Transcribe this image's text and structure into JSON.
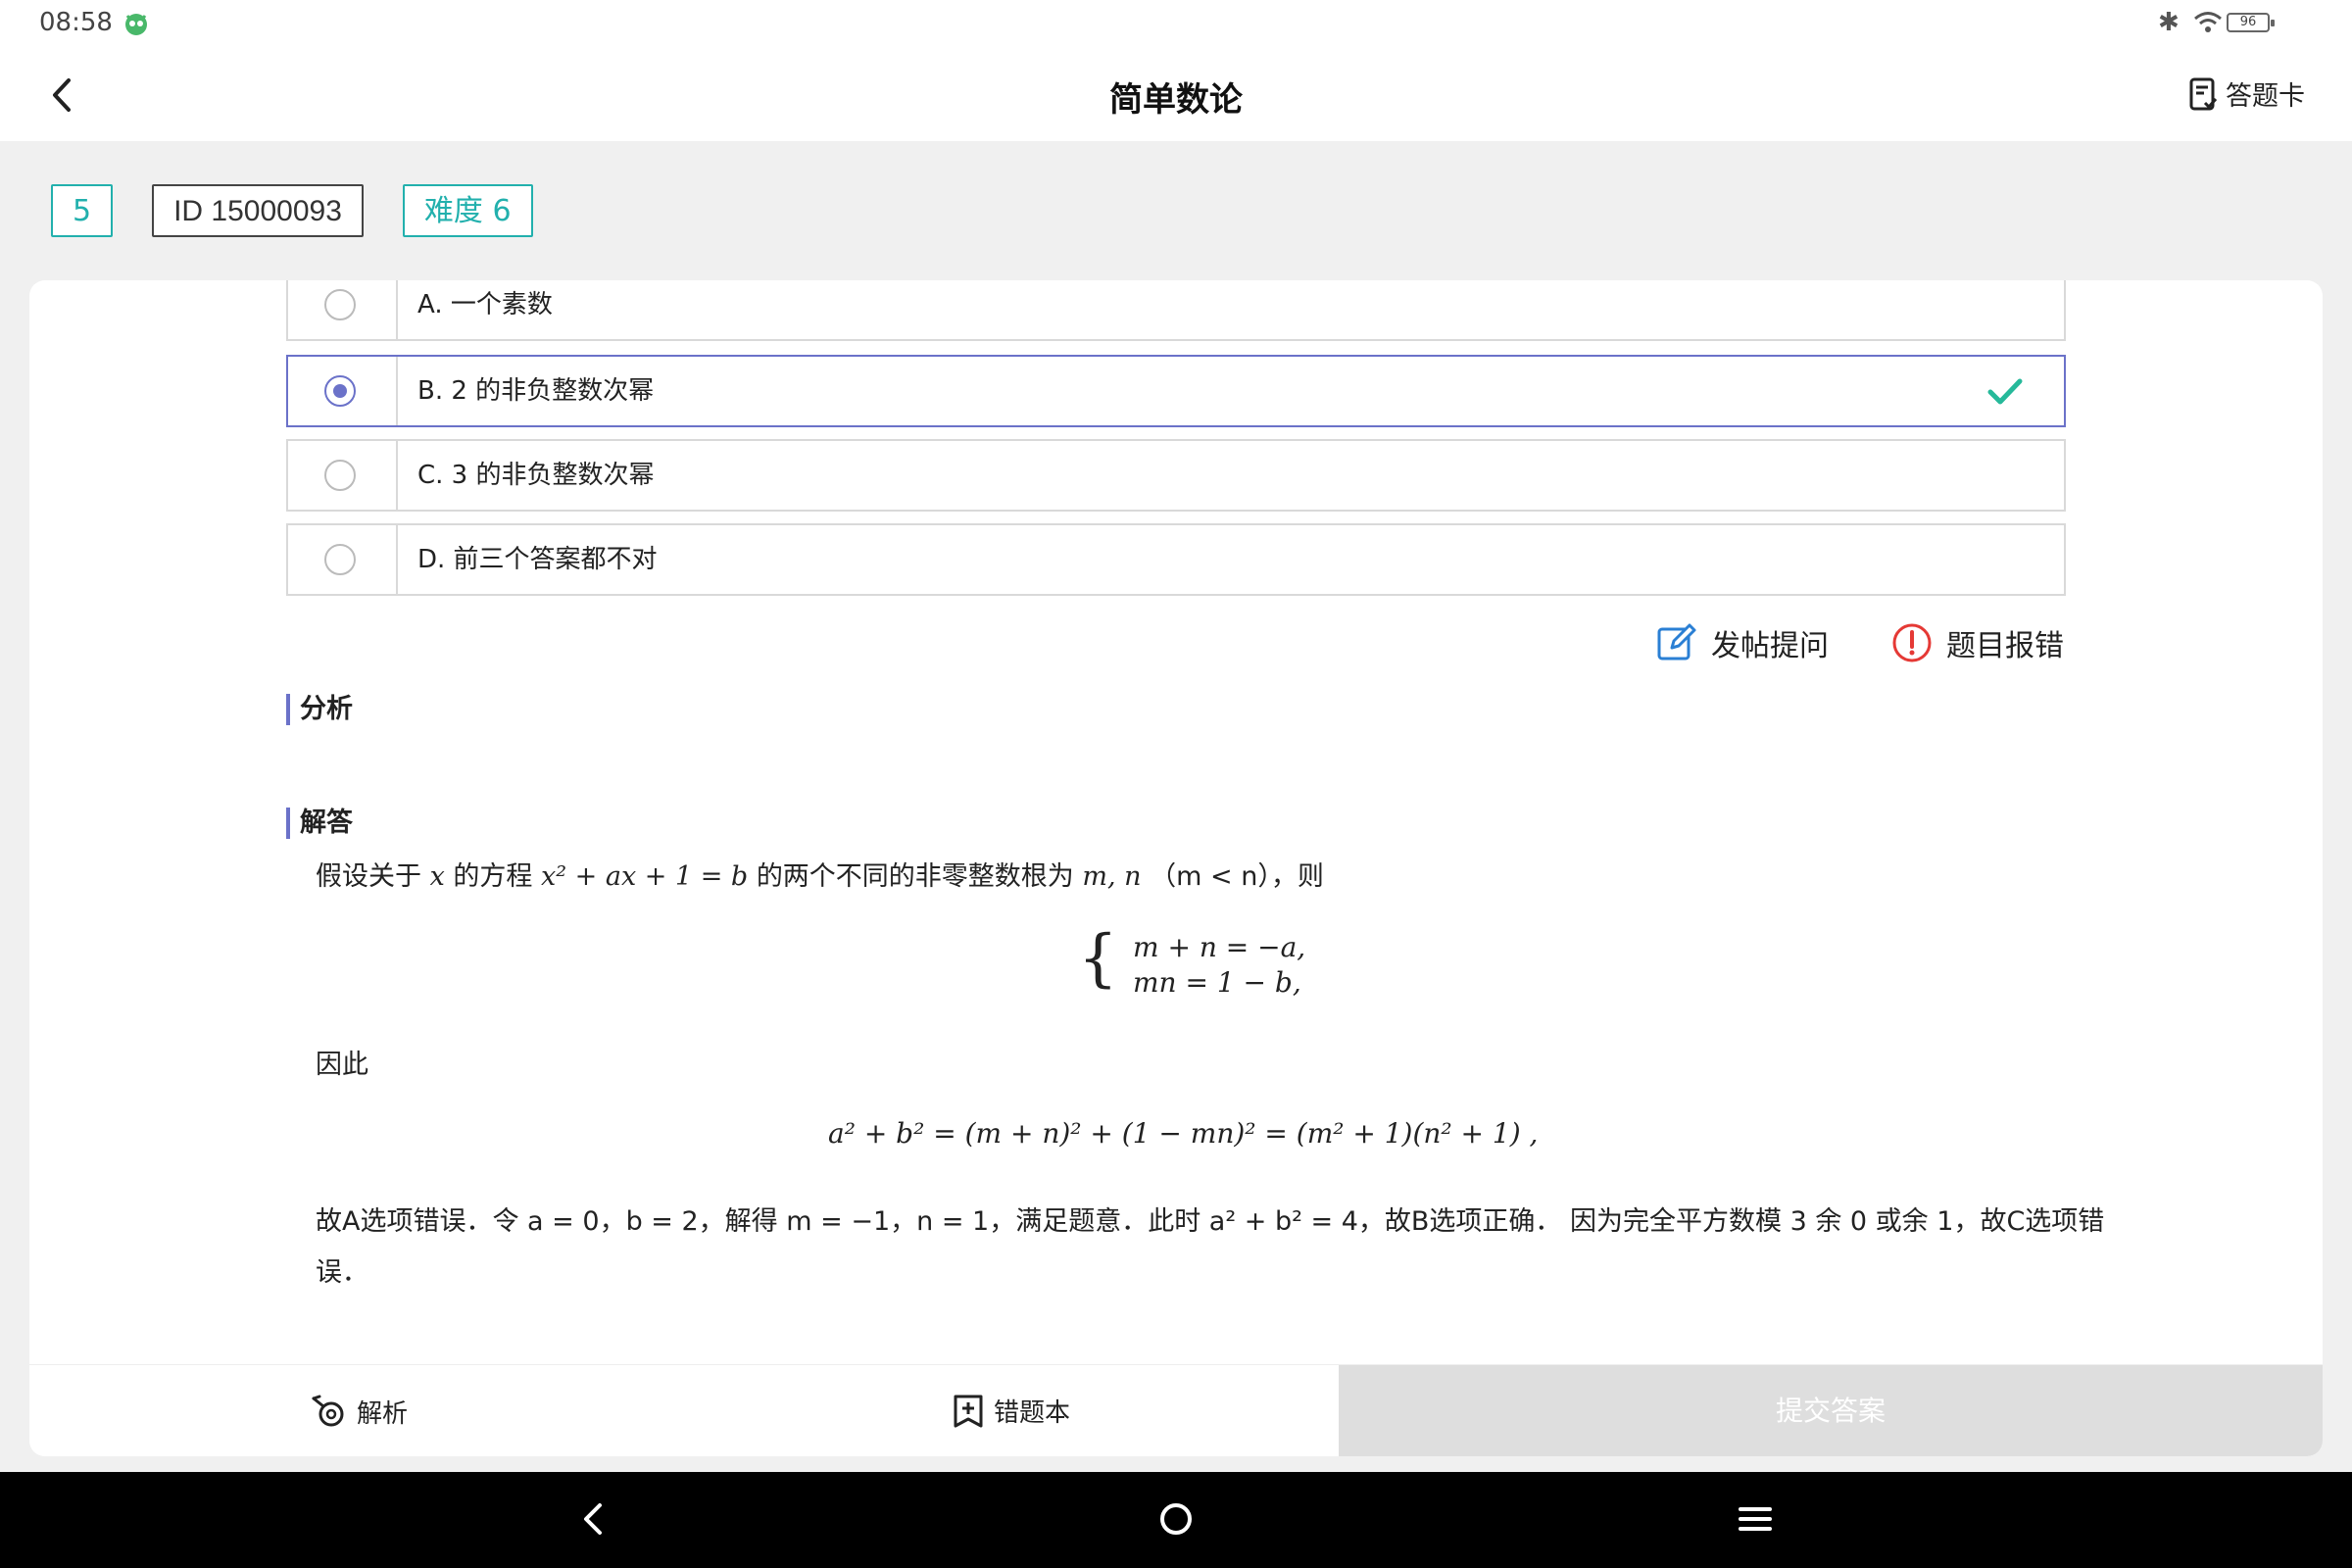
{
  "status_bar": {
    "time": "08:58",
    "battery": "96"
  },
  "header": {
    "title": "简单数论",
    "answer_card_label": "答题卡"
  },
  "badges": {
    "number": "5",
    "id": "ID 15000093",
    "difficulty": "难度 6"
  },
  "options": [
    {
      "label": "A. 一个素数",
      "selected": false
    },
    {
      "label": "B. 2 的非负整数次幂",
      "selected": true,
      "correct": true
    },
    {
      "label": "C. 3 的非负整数次幂",
      "selected": false
    },
    {
      "label": "D. 前三个答案都不对",
      "selected": false
    }
  ],
  "actions": {
    "post_question": "发帖提问",
    "report_error": "题目报错"
  },
  "sections": {
    "analysis_title": "分析",
    "answer_title": "解答"
  },
  "solution": {
    "p1_a": "假设关于",
    "p1_var": "x",
    "p1_b": "的方程",
    "p1_eq": "x² + ax + 1 = b",
    "p1_c": "的两个不同的非零整数根为",
    "p1_roots": "m, n",
    "p1_cond": "（m < n），则",
    "sys_line1": "m + n = −a,",
    "sys_line2": "mn = 1 − b,",
    "p2": "因此",
    "eq2": "a² + b² = (m + n)² + (1 − mn)² = (m² + 1)(n² + 1) ,",
    "p3_line1": "故A选项错误．令 a = 0，b = 2，解得 m = −1，n = 1，满足题意．此时 a² + b² = 4，故B选项正确． 因为完全平方数模 3 余 0 或余 1，故C选项错",
    "p3_line2": "误．"
  },
  "bottom_bar": {
    "analysis": "解析",
    "wrong_book": "错题本",
    "submit": "提交答案"
  },
  "colors": {
    "accent": "#6b72c9",
    "teal": "#22b0ad",
    "check": "#26b99a",
    "error": "#e53935"
  }
}
